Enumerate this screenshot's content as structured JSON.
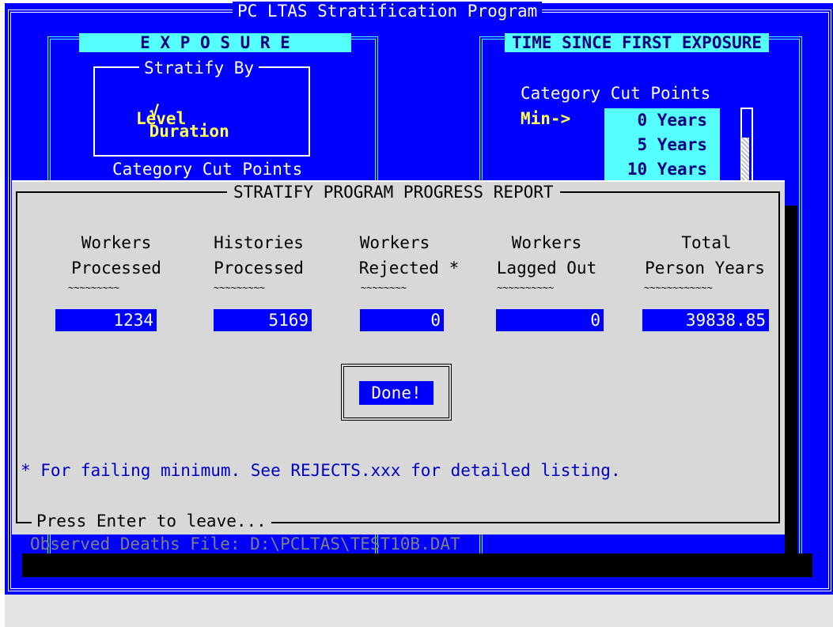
{
  "app": {
    "title": "PC LTAS Stratification Program"
  },
  "exposure": {
    "header": "E X P O S U R E",
    "stratify_by_title": "Stratify By",
    "options": [
      {
        "mark": "√",
        "label": "Duration"
      },
      {
        "mark": "",
        "label": "Level"
      }
    ],
    "cut_points_title": "Category Cut Points"
  },
  "time_since_first_exposure": {
    "header": "TIME SINCE FIRST EXPOSURE",
    "cut_points_title": "Category Cut Points",
    "min_label": "Min->",
    "cut_points": [
      "0 Years",
      "5 Years",
      "10 Years"
    ]
  },
  "observed_deaths": {
    "label": "Observed Deaths File: D:\\PCLTAS\\TEST10B.DAT"
  },
  "dialog": {
    "title": "STRATIFY PROGRAM PROGRESS REPORT",
    "columns": [
      {
        "line1": "Workers",
        "line2": "Processed",
        "tilde": "~~~~~~~~~",
        "value": "1234"
      },
      {
        "line1": "Histories",
        "line2": "Processed",
        "tilde": "~~~~~~~~~",
        "value": "5169"
      },
      {
        "line1": "Workers",
        "line2": "Rejected *",
        "tilde": "~~~~~~~~",
        "value": "0"
      },
      {
        "line1": "Workers",
        "line2": "Lagged Out",
        "tilde": "~~~~~~~~~~",
        "value": "0"
      },
      {
        "line1": "Total",
        "line2": "Person Years",
        "tilde": "~~~~~~~~~~~~",
        "value": "39838.85"
      }
    ],
    "done_label": "Done!",
    "footnote": "* For failing minimum. See REJECTS.xxx for detailed listing.",
    "press_enter": "Press Enter to leave..."
  },
  "colors": {
    "screen_bg": "#0000ff",
    "accent_cyan": "#55ffff",
    "highlight_yellow": "#ffff55",
    "dialog_bg": "#d8d8d8"
  }
}
